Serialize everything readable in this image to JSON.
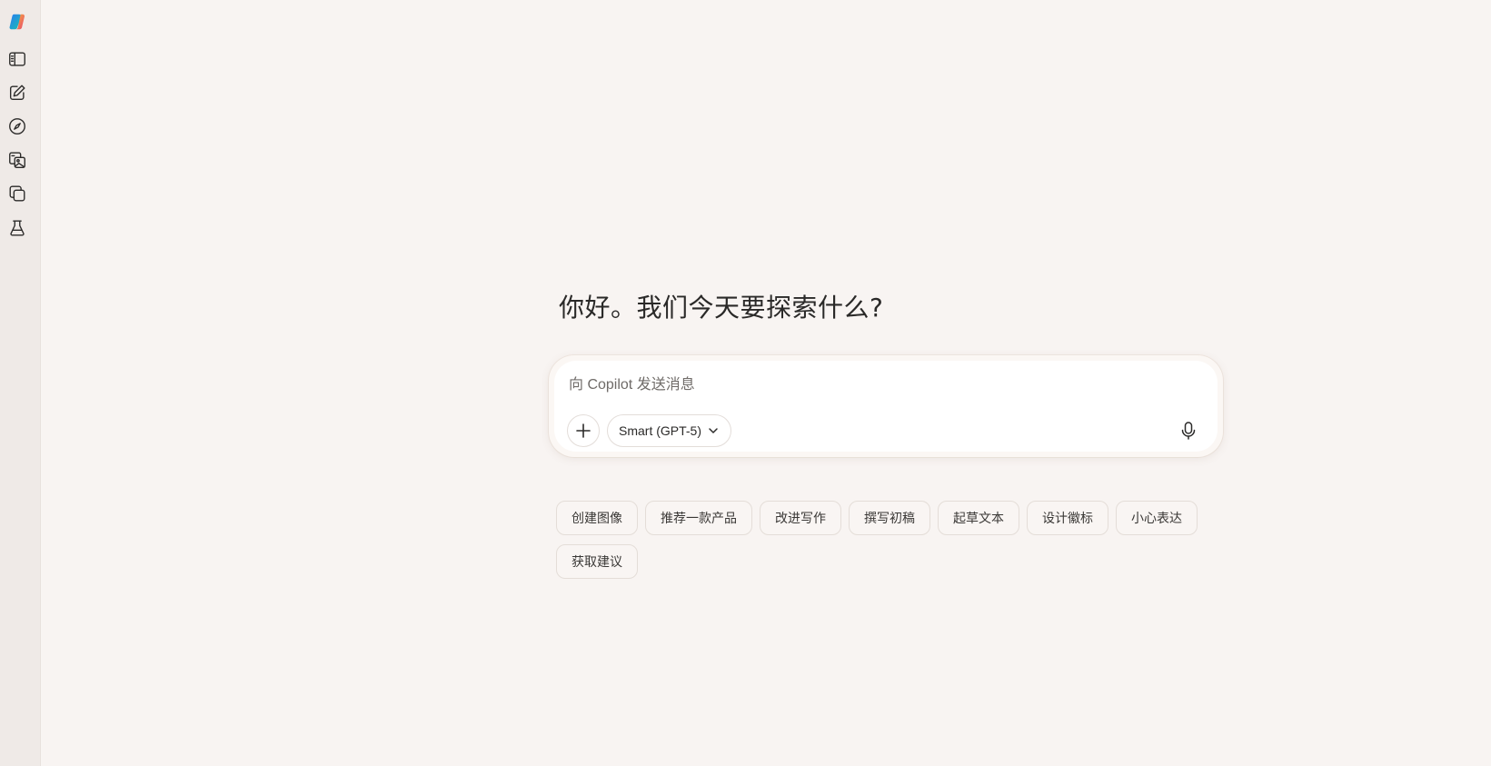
{
  "sidebar": {
    "items": [
      {
        "icon": "copilot-logo-icon"
      },
      {
        "icon": "sidebar-toggle-icon"
      },
      {
        "icon": "new-chat-icon"
      },
      {
        "icon": "discover-compass-icon"
      },
      {
        "icon": "images-library-icon"
      },
      {
        "icon": "pages-copy-icon"
      },
      {
        "icon": "labs-flask-icon"
      }
    ]
  },
  "main": {
    "greeting": "你好。我们今天要探索什么?",
    "composer": {
      "placeholder": "向 Copilot 发送消息",
      "value": "",
      "model_label": "Smart (GPT-5)"
    },
    "suggestions": [
      "创建图像",
      "推荐一款产品",
      "改进写作",
      "撰写初稿",
      "起草文本",
      "设计徽标",
      "小心表达",
      "获取建议"
    ]
  },
  "colors": {
    "background": "#f8f4f2",
    "sidebar": "#efeae7",
    "composer": "#ffffff",
    "text": "#2b2a29"
  }
}
